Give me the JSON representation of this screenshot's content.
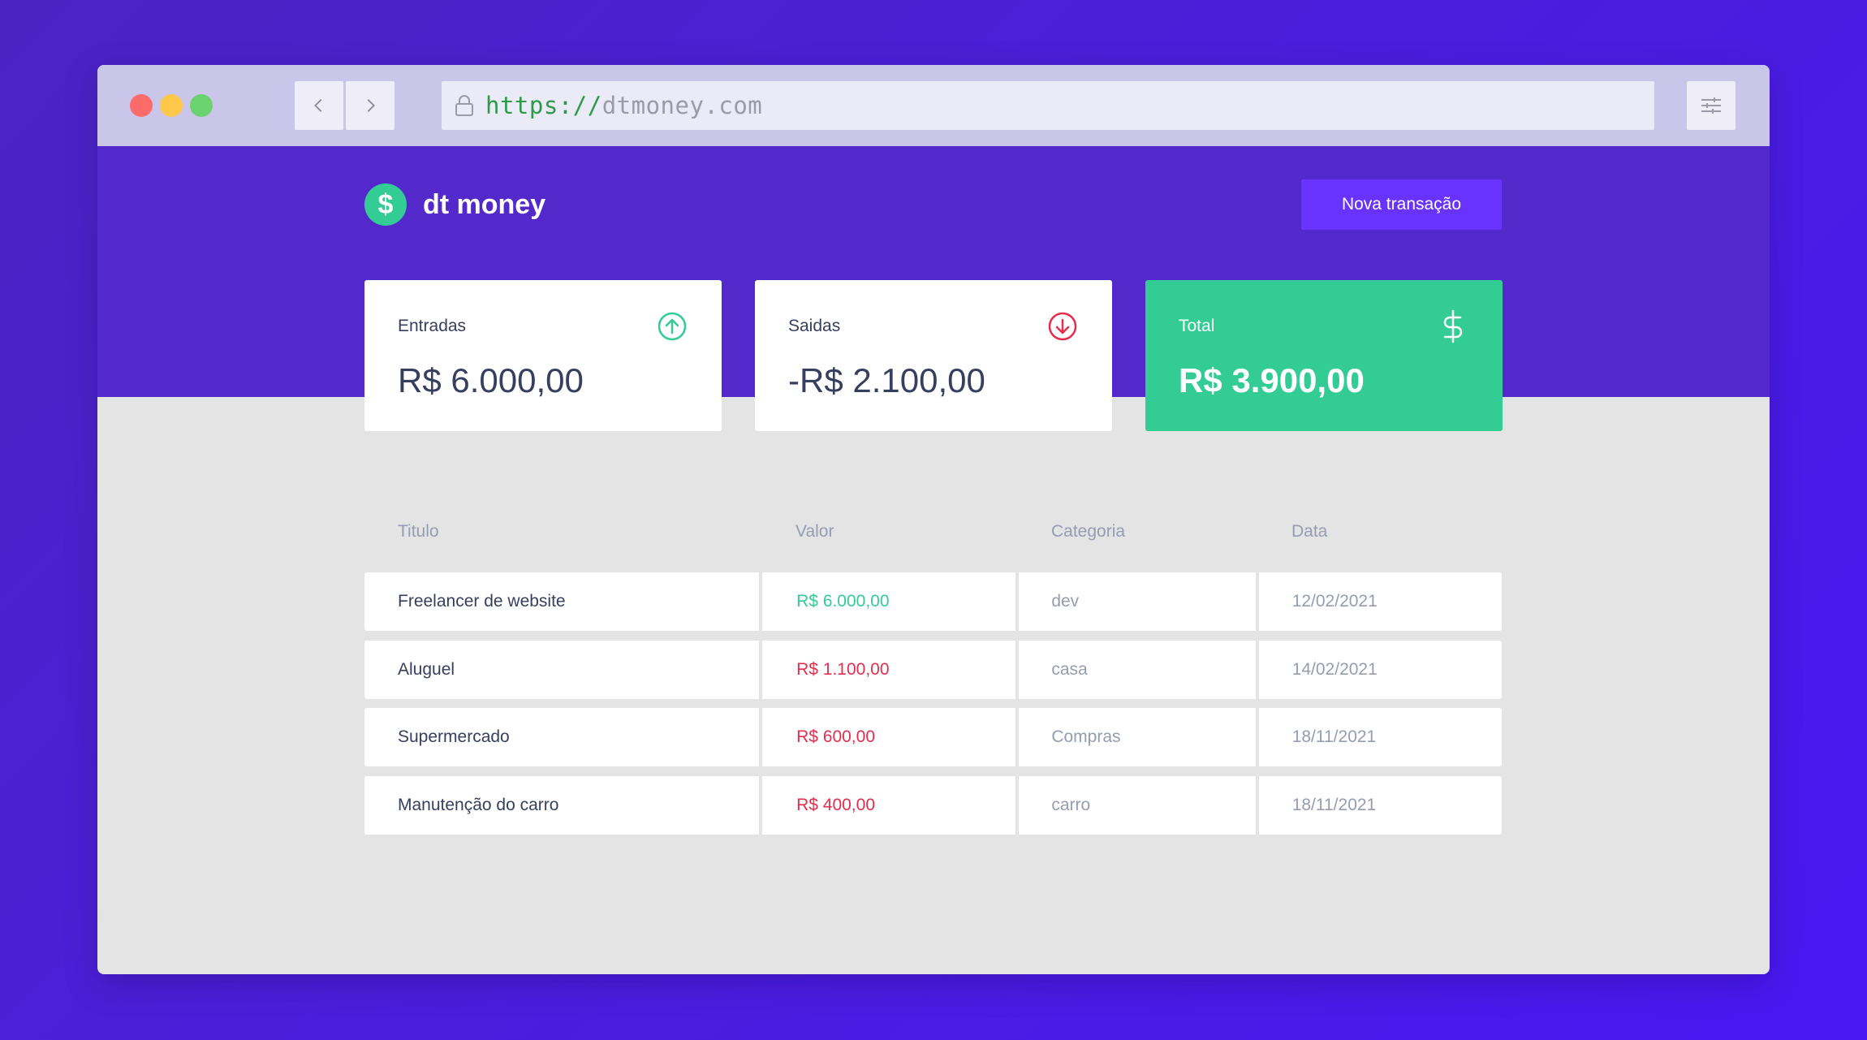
{
  "browser": {
    "url_protocol": "https://",
    "url_host": "dtmoney.com"
  },
  "app": {
    "logo_symbol": "$",
    "name": "dt money",
    "new_transaction_label": "Nova transação"
  },
  "summary": {
    "income": {
      "label": "Entradas",
      "amount": "R$ 6.000,00",
      "icon": "arrow-up-circle-icon"
    },
    "outcome": {
      "label": "Saidas",
      "amount": "-R$ 2.100,00",
      "icon": "arrow-down-circle-icon"
    },
    "total": {
      "label": "Total",
      "amount": "R$ 3.900,00",
      "icon": "dollar-icon"
    }
  },
  "table": {
    "headers": [
      "Titulo",
      "Valor",
      "Categoria",
      "Data"
    ],
    "rows": [
      {
        "title": "Freelancer de website",
        "value": "R$ 6.000,00",
        "type": "deposit",
        "category": "dev",
        "date": "12/02/2021"
      },
      {
        "title": "Aluguel",
        "value": "R$ 1.100,00",
        "type": "withdraw",
        "category": "casa",
        "date": "14/02/2021"
      },
      {
        "title": "Supermercado",
        "value": "R$ 600,00",
        "type": "withdraw",
        "category": "Compras",
        "date": "18/11/2021"
      },
      {
        "title": "Manutenção do carro",
        "value": "R$ 400,00",
        "type": "withdraw",
        "category": "carro",
        "date": "18/11/2021"
      }
    ]
  },
  "colors": {
    "brand_purple": "#5429cc",
    "button_purple": "#6933ff",
    "green": "#33cc95",
    "red": "#e52e4d"
  }
}
